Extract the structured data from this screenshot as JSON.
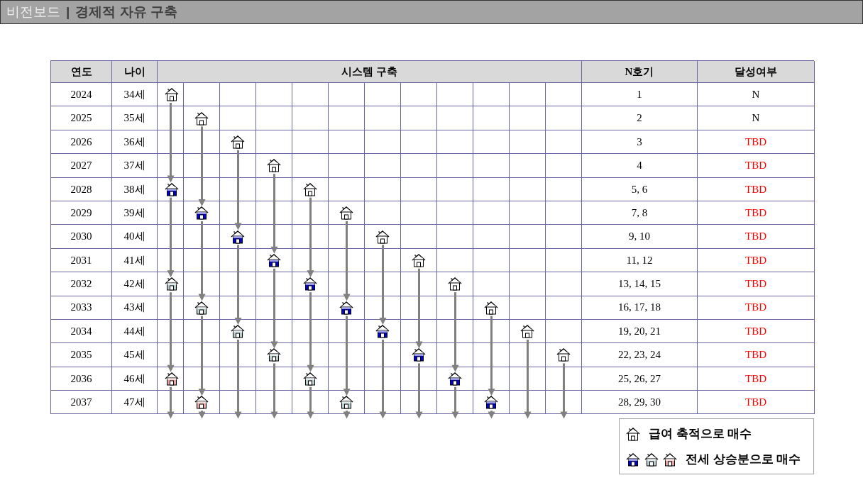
{
  "title": {
    "section": "비전보드",
    "separator": "|",
    "page": "경제적 자유 구축"
  },
  "table": {
    "columns": {
      "year": "연도",
      "age": "나이",
      "system": "시스템 구축",
      "unit": "N호기",
      "status": "달성여부"
    },
    "rows": [
      {
        "year": "2024",
        "age": "34세",
        "cells": [
          {
            "kind": "salary"
          },
          {
            "kind": "empty"
          },
          {
            "kind": "empty"
          },
          {
            "kind": "empty"
          },
          {
            "kind": "empty"
          },
          {
            "kind": "empty"
          },
          {
            "kind": "empty"
          },
          {
            "kind": "empty"
          },
          {
            "kind": "empty"
          },
          {
            "kind": "empty"
          },
          {
            "kind": "empty"
          },
          {
            "kind": "empty"
          }
        ],
        "unit": "1",
        "status": "N",
        "color": "#000000"
      },
      {
        "year": "2025",
        "age": "35세",
        "cells": [
          {
            "kind": "empty"
          },
          {
            "kind": "salary"
          },
          {
            "kind": "empty"
          },
          {
            "kind": "empty"
          },
          {
            "kind": "empty"
          },
          {
            "kind": "empty"
          },
          {
            "kind": "empty"
          },
          {
            "kind": "empty"
          },
          {
            "kind": "empty"
          },
          {
            "kind": "empty"
          },
          {
            "kind": "empty"
          },
          {
            "kind": "empty"
          }
        ],
        "unit": "2",
        "status": "N",
        "color": "#000000"
      },
      {
        "year": "2026",
        "age": "36세",
        "cells": [
          {
            "kind": "empty"
          },
          {
            "kind": "empty"
          },
          {
            "kind": "salary"
          },
          {
            "kind": "empty"
          },
          {
            "kind": "empty"
          },
          {
            "kind": "empty"
          },
          {
            "kind": "empty"
          },
          {
            "kind": "empty"
          },
          {
            "kind": "empty"
          },
          {
            "kind": "empty"
          },
          {
            "kind": "empty"
          },
          {
            "kind": "empty"
          }
        ],
        "unit": "3",
        "status": "TBD",
        "color": "#ff0000"
      },
      {
        "year": "2027",
        "age": "37세",
        "cells": [
          {
            "kind": "empty"
          },
          {
            "kind": "empty"
          },
          {
            "kind": "empty"
          },
          {
            "kind": "salary"
          },
          {
            "kind": "empty"
          },
          {
            "kind": "empty"
          },
          {
            "kind": "empty"
          },
          {
            "kind": "empty"
          },
          {
            "kind": "empty"
          },
          {
            "kind": "empty"
          },
          {
            "kind": "empty"
          },
          {
            "kind": "empty"
          }
        ],
        "unit": "4",
        "status": "TBD",
        "color": "#ff0000"
      },
      {
        "year": "2028",
        "age": "38세",
        "cells": [
          {
            "kind": "blue"
          },
          {
            "kind": "empty"
          },
          {
            "kind": "empty"
          },
          {
            "kind": "empty"
          },
          {
            "kind": "salary"
          },
          {
            "kind": "empty"
          },
          {
            "kind": "empty"
          },
          {
            "kind": "empty"
          },
          {
            "kind": "empty"
          },
          {
            "kind": "empty"
          },
          {
            "kind": "empty"
          },
          {
            "kind": "empty"
          }
        ],
        "unit": "5, 6",
        "status": "TBD",
        "color": "#ff0000"
      },
      {
        "year": "2029",
        "age": "39세",
        "cells": [
          {
            "kind": "empty"
          },
          {
            "kind": "blue"
          },
          {
            "kind": "empty"
          },
          {
            "kind": "empty"
          },
          {
            "kind": "empty"
          },
          {
            "kind": "salary"
          },
          {
            "kind": "empty"
          },
          {
            "kind": "empty"
          },
          {
            "kind": "empty"
          },
          {
            "kind": "empty"
          },
          {
            "kind": "empty"
          },
          {
            "kind": "empty"
          }
        ],
        "unit": "7, 8",
        "status": "TBD",
        "color": "#ff0000"
      },
      {
        "year": "2030",
        "age": "40세",
        "cells": [
          {
            "kind": "empty"
          },
          {
            "kind": "empty"
          },
          {
            "kind": "blue"
          },
          {
            "kind": "empty"
          },
          {
            "kind": "empty"
          },
          {
            "kind": "empty"
          },
          {
            "kind": "salary"
          },
          {
            "kind": "empty"
          },
          {
            "kind": "empty"
          },
          {
            "kind": "empty"
          },
          {
            "kind": "empty"
          },
          {
            "kind": "empty"
          }
        ],
        "unit": "9, 10",
        "status": "TBD",
        "color": "#ff0000"
      },
      {
        "year": "2031",
        "age": "41세",
        "cells": [
          {
            "kind": "empty"
          },
          {
            "kind": "empty"
          },
          {
            "kind": "empty"
          },
          {
            "kind": "blue"
          },
          {
            "kind": "empty"
          },
          {
            "kind": "empty"
          },
          {
            "kind": "empty"
          },
          {
            "kind": "salary"
          },
          {
            "kind": "empty"
          },
          {
            "kind": "empty"
          },
          {
            "kind": "empty"
          },
          {
            "kind": "empty"
          }
        ],
        "unit": "11, 12",
        "status": "TBD",
        "color": "#ff0000"
      },
      {
        "year": "2032",
        "age": "42세",
        "cells": [
          {
            "kind": "teal"
          },
          {
            "kind": "empty"
          },
          {
            "kind": "empty"
          },
          {
            "kind": "empty"
          },
          {
            "kind": "blue"
          },
          {
            "kind": "empty"
          },
          {
            "kind": "empty"
          },
          {
            "kind": "empty"
          },
          {
            "kind": "salary"
          },
          {
            "kind": "empty"
          },
          {
            "kind": "empty"
          },
          {
            "kind": "empty"
          }
        ],
        "unit": "13, 14, 15",
        "status": "TBD",
        "color": "#ff0000"
      },
      {
        "year": "2033",
        "age": "43세",
        "cells": [
          {
            "kind": "empty"
          },
          {
            "kind": "teal"
          },
          {
            "kind": "empty"
          },
          {
            "kind": "empty"
          },
          {
            "kind": "empty"
          },
          {
            "kind": "blue"
          },
          {
            "kind": "empty"
          },
          {
            "kind": "empty"
          },
          {
            "kind": "empty"
          },
          {
            "kind": "salary"
          },
          {
            "kind": "empty"
          },
          {
            "kind": "empty"
          }
        ],
        "unit": "16, 17, 18",
        "status": "TBD",
        "color": "#ff0000"
      },
      {
        "year": "2034",
        "age": "44세",
        "cells": [
          {
            "kind": "empty"
          },
          {
            "kind": "empty"
          },
          {
            "kind": "teal"
          },
          {
            "kind": "empty"
          },
          {
            "kind": "empty"
          },
          {
            "kind": "empty"
          },
          {
            "kind": "blue"
          },
          {
            "kind": "empty"
          },
          {
            "kind": "empty"
          },
          {
            "kind": "empty"
          },
          {
            "kind": "salary"
          },
          {
            "kind": "empty"
          }
        ],
        "unit": "19, 20, 21",
        "status": "TBD",
        "color": "#ff0000"
      },
      {
        "year": "2035",
        "age": "45세",
        "cells": [
          {
            "kind": "empty"
          },
          {
            "kind": "empty"
          },
          {
            "kind": "empty"
          },
          {
            "kind": "teal"
          },
          {
            "kind": "empty"
          },
          {
            "kind": "empty"
          },
          {
            "kind": "empty"
          },
          {
            "kind": "blue"
          },
          {
            "kind": "empty"
          },
          {
            "kind": "empty"
          },
          {
            "kind": "empty"
          },
          {
            "kind": "salary"
          }
        ],
        "unit": "22, 23, 24",
        "status": "TBD",
        "color": "#ff0000"
      },
      {
        "year": "2036",
        "age": "46세",
        "cells": [
          {
            "kind": "pink"
          },
          {
            "kind": "empty"
          },
          {
            "kind": "empty"
          },
          {
            "kind": "empty"
          },
          {
            "kind": "teal"
          },
          {
            "kind": "empty"
          },
          {
            "kind": "empty"
          },
          {
            "kind": "empty"
          },
          {
            "kind": "blue"
          },
          {
            "kind": "empty"
          },
          {
            "kind": "empty"
          },
          {
            "kind": "empty"
          }
        ],
        "unit": "25, 26, 27",
        "status": "TBD",
        "color": "#ff0000"
      },
      {
        "year": "2037",
        "age": "47세",
        "cells": [
          {
            "kind": "empty"
          },
          {
            "kind": "pink"
          },
          {
            "kind": "empty"
          },
          {
            "kind": "empty"
          },
          {
            "kind": "empty"
          },
          {
            "kind": "teal"
          },
          {
            "kind": "empty"
          },
          {
            "kind": "empty"
          },
          {
            "kind": "empty"
          },
          {
            "kind": "blue"
          },
          {
            "kind": "empty"
          },
          {
            "kind": "empty"
          }
        ],
        "unit": "28, 29, 30",
        "status": "TBD",
        "color": "#ff0000"
      }
    ]
  },
  "legend": [
    {
      "houses": [
        {
          "kind": "salary"
        }
      ],
      "label": "급여 축적으로 매수"
    },
    {
      "houses": [
        {
          "kind": "blue"
        },
        {
          "kind": "teal"
        },
        {
          "kind": "pink"
        }
      ],
      "label": "전세 상승분으로 매수"
    }
  ]
}
